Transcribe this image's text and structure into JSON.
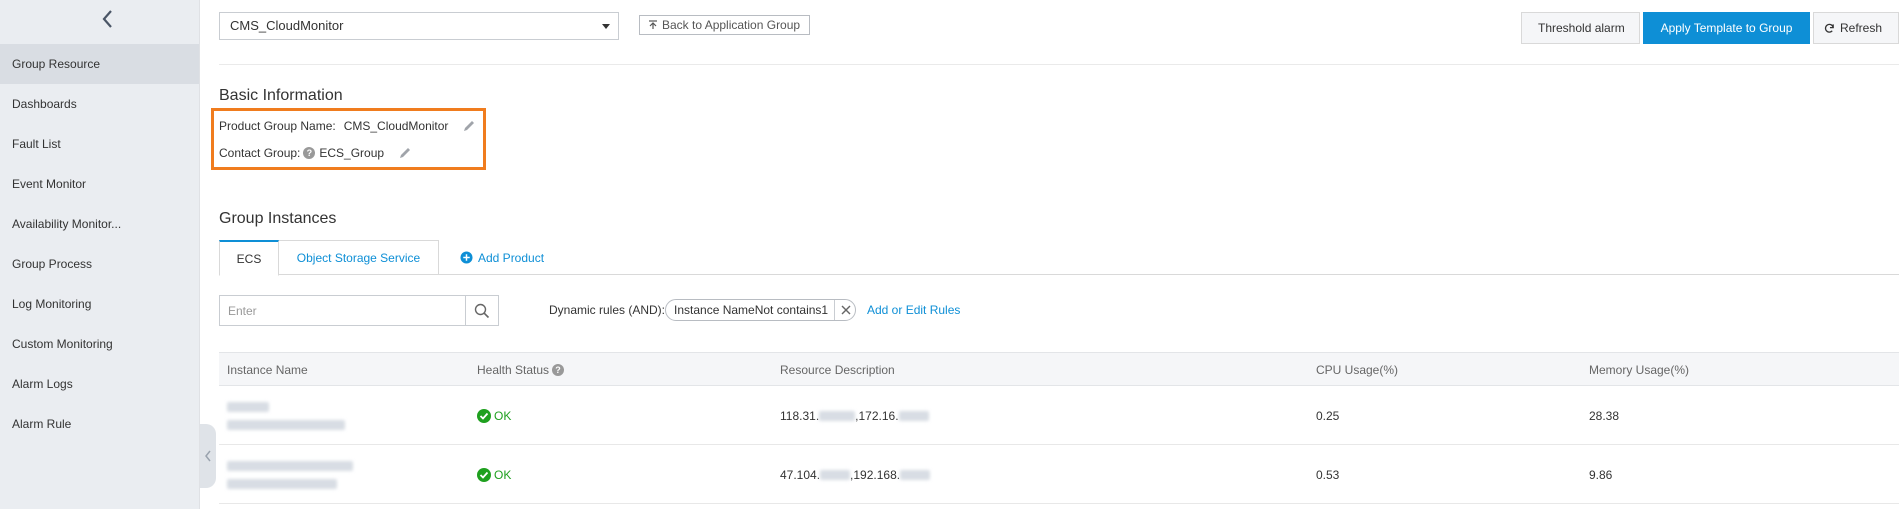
{
  "sidebar": {
    "items": [
      {
        "label": "Group Resource",
        "active": true
      },
      {
        "label": "Dashboards"
      },
      {
        "label": "Fault List"
      },
      {
        "label": "Event Monitor"
      },
      {
        "label": "Availability Monitor..."
      },
      {
        "label": "Group Process"
      },
      {
        "label": "Log Monitoring"
      },
      {
        "label": "Custom Monitoring"
      },
      {
        "label": "Alarm Logs"
      },
      {
        "label": "Alarm Rule"
      }
    ]
  },
  "header": {
    "group_select_value": "CMS_CloudMonitor",
    "back_label": "Back to Application Group",
    "threshold_label": "Threshold alarm",
    "apply_template_label": "Apply Template to Group",
    "refresh_label": "Refresh"
  },
  "basic_info": {
    "title": "Basic Information",
    "product_group_label": "Product Group Name:",
    "product_group_value": "CMS_CloudMonitor",
    "contact_group_label": "Contact Group:",
    "contact_group_value": "ECS_Group"
  },
  "instances": {
    "title": "Group Instances",
    "tabs": [
      "ECS",
      "Object Storage Service"
    ],
    "add_product_label": "Add Product",
    "search_placeholder": "Enter",
    "dynamic_rules_label": "Dynamic rules (AND):",
    "rule_chip": "Instance NameNot contains1",
    "add_rules_label": "Add or Edit Rules",
    "columns": [
      "Instance Name",
      "Health Status",
      "Resource Description",
      "CPU Usage(%)",
      "Memory Usage(%)"
    ],
    "rows": [
      {
        "health": "OK",
        "res_a": "118.31.",
        "res_b": ",172.16.",
        "cpu": "0.25",
        "mem": "28.38"
      },
      {
        "health": "OK",
        "res_a": "47.104.",
        "res_b": ",192.168.",
        "cpu": "0.53",
        "mem": "9.86"
      }
    ]
  },
  "colors": {
    "accent": "#0e8fd6",
    "highlight": "#f07c1e",
    "ok": "#1fa01f"
  }
}
